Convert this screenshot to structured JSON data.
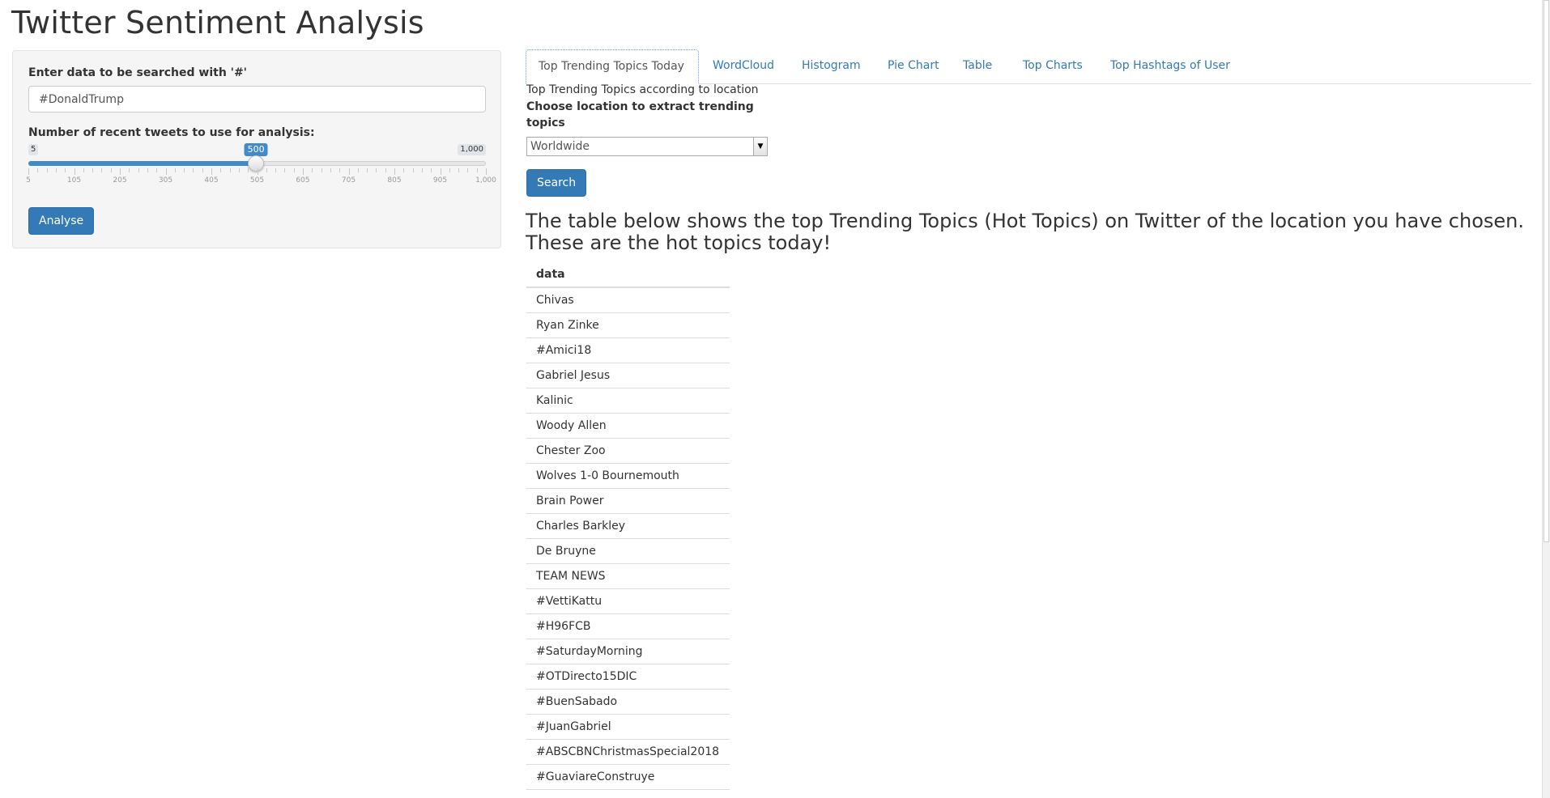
{
  "app": {
    "title": "Twitter Sentiment Analysis"
  },
  "sidebar": {
    "search_label": "Enter data to be searched with '#'",
    "search_value": "#DonaldTrump",
    "slider_label": "Number of recent tweets to use for analysis:",
    "slider": {
      "min": 5,
      "max": 1000,
      "value": 500,
      "min_label": "5",
      "max_label": "1,000",
      "value_label": "500",
      "tick_labels": [
        "5",
        "105",
        "205",
        "305",
        "405",
        "505",
        "605",
        "705",
        "805",
        "905",
        "1,000"
      ]
    },
    "analyse_button": "Analyse"
  },
  "tabs": [
    {
      "label": "Top Trending Topics Today",
      "active": true
    },
    {
      "label": "WordCloud",
      "active": false
    },
    {
      "label": "Histogram",
      "active": false
    },
    {
      "label": "Pie Chart",
      "active": false
    },
    {
      "label": "Table",
      "active": false
    },
    {
      "label": "Top Charts",
      "active": false
    },
    {
      "label": "Top Hashtags of User",
      "active": false
    }
  ],
  "pane": {
    "subtitle": "Top Trending Topics according to location",
    "location_label": "Choose location to extract trending topics",
    "location_value": "Worldwide",
    "search_button": "Search",
    "heading": "The table below shows the top Trending Topics (Hot Topics) on Twitter of the location you have chosen. These are the hot topics today!",
    "table": {
      "header": "data",
      "rows": [
        "Chivas",
        "Ryan Zinke",
        "#Amici18",
        "Gabriel Jesus",
        "Kalinic",
        "Woody Allen",
        "Chester Zoo",
        "Wolves 1-0 Bournemouth",
        "Brain Power",
        "Charles Barkley",
        "De Bruyne",
        "TEAM NEWS",
        "#VettiKattu",
        "#H96FCB",
        "#SaturdayMorning",
        "#OTDirecto15DIC",
        "#BuenSabado",
        "#JuanGabriel",
        "#ABSCBNChristmasSpecial2018",
        "#GuaviareConstruye"
      ]
    }
  },
  "colors": {
    "accent": "#337ab7",
    "slider_fill": "#428bca",
    "panel_bg": "#f5f5f5"
  }
}
